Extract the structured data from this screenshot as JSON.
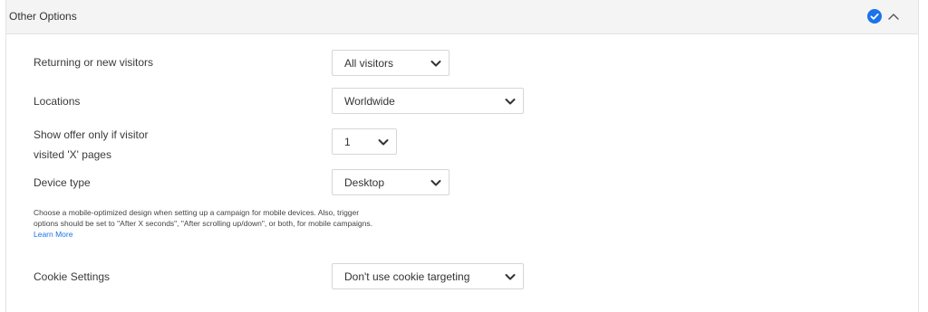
{
  "section": {
    "title": "Other Options",
    "accent_color": "#1a73e8",
    "icons": [
      "check-circle-icon",
      "chevron-up-icon"
    ]
  },
  "rows": {
    "returning": {
      "label": "Returning or new visitors",
      "value": "All visitors"
    },
    "locations": {
      "label": "Locations",
      "value": "Worldwide"
    },
    "pages": {
      "label_line1": "Show offer only if visitor",
      "label_line2": "visited 'X' pages",
      "value": "1"
    },
    "device": {
      "label": "Device type",
      "value": "Desktop"
    },
    "cookie": {
      "label": "Cookie Settings",
      "value": "Don't use cookie targeting"
    }
  },
  "device_note": {
    "line1": "Choose a mobile-optimized design when setting up a campaign for mobile devices. Also, trigger",
    "line2": "options should be set to \"After X seconds\", \"After scrolling up/down\", or both, for mobile campaigns.",
    "link": "Learn More"
  }
}
